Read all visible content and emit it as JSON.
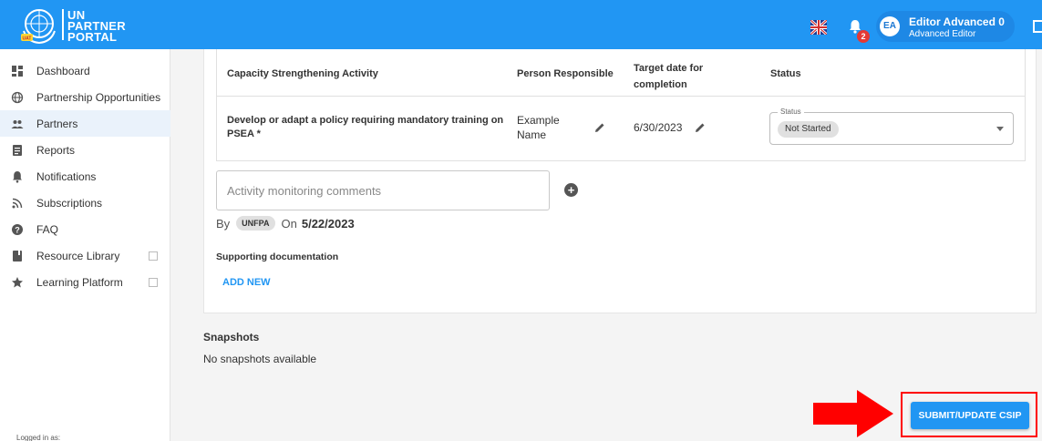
{
  "header": {
    "brand_line1": "UN",
    "brand_line2": "PARTNER",
    "brand_line3": "PORTAL",
    "notification_count": "2",
    "avatar_initials": "EA",
    "user_name": "Editor Advanced 0",
    "user_role": "Advanced Editor",
    "accent_color": "#2196f3"
  },
  "sidebar": {
    "items": [
      {
        "label": "Dashboard",
        "icon": "dashboard-icon"
      },
      {
        "label": "Partnership Opportunities",
        "icon": "globe-icon"
      },
      {
        "label": "Partners",
        "icon": "people-icon",
        "active": true
      },
      {
        "label": "Reports",
        "icon": "report-icon"
      },
      {
        "label": "Notifications",
        "icon": "bell-icon"
      },
      {
        "label": "Subscriptions",
        "icon": "rss-icon"
      },
      {
        "label": "FAQ",
        "icon": "help-icon"
      },
      {
        "label": "Resource Library",
        "icon": "book-icon",
        "external": true
      },
      {
        "label": "Learning Platform",
        "icon": "star-icon",
        "external": true
      }
    ],
    "logged_in_label": "Logged in as:"
  },
  "table": {
    "headers": {
      "activity": "Capacity Strengthening Activity",
      "person": "Person Responsible",
      "target_line1": "Target date for",
      "target_line2": "completion",
      "status": "Status"
    },
    "row": {
      "activity_line1": "Develop or adapt a policy requiring mandatory training on",
      "activity_line2": "PSEA *",
      "person_line1": "Example",
      "person_line2": "Name",
      "target_date": "6/30/2023",
      "status_legend": "Status",
      "status_value": "Not Started"
    }
  },
  "comments": {
    "placeholder": "Activity monitoring comments",
    "by_label": "By",
    "org": "UNFPA",
    "on_label": "On",
    "date": "5/22/2023"
  },
  "supporting": {
    "title": "Supporting documentation",
    "add_new": "ADD NEW"
  },
  "snapshots": {
    "title": "Snapshots",
    "empty": "No snapshots available"
  },
  "actions": {
    "submit_label": "SUBMIT/UPDATE CSIP"
  }
}
